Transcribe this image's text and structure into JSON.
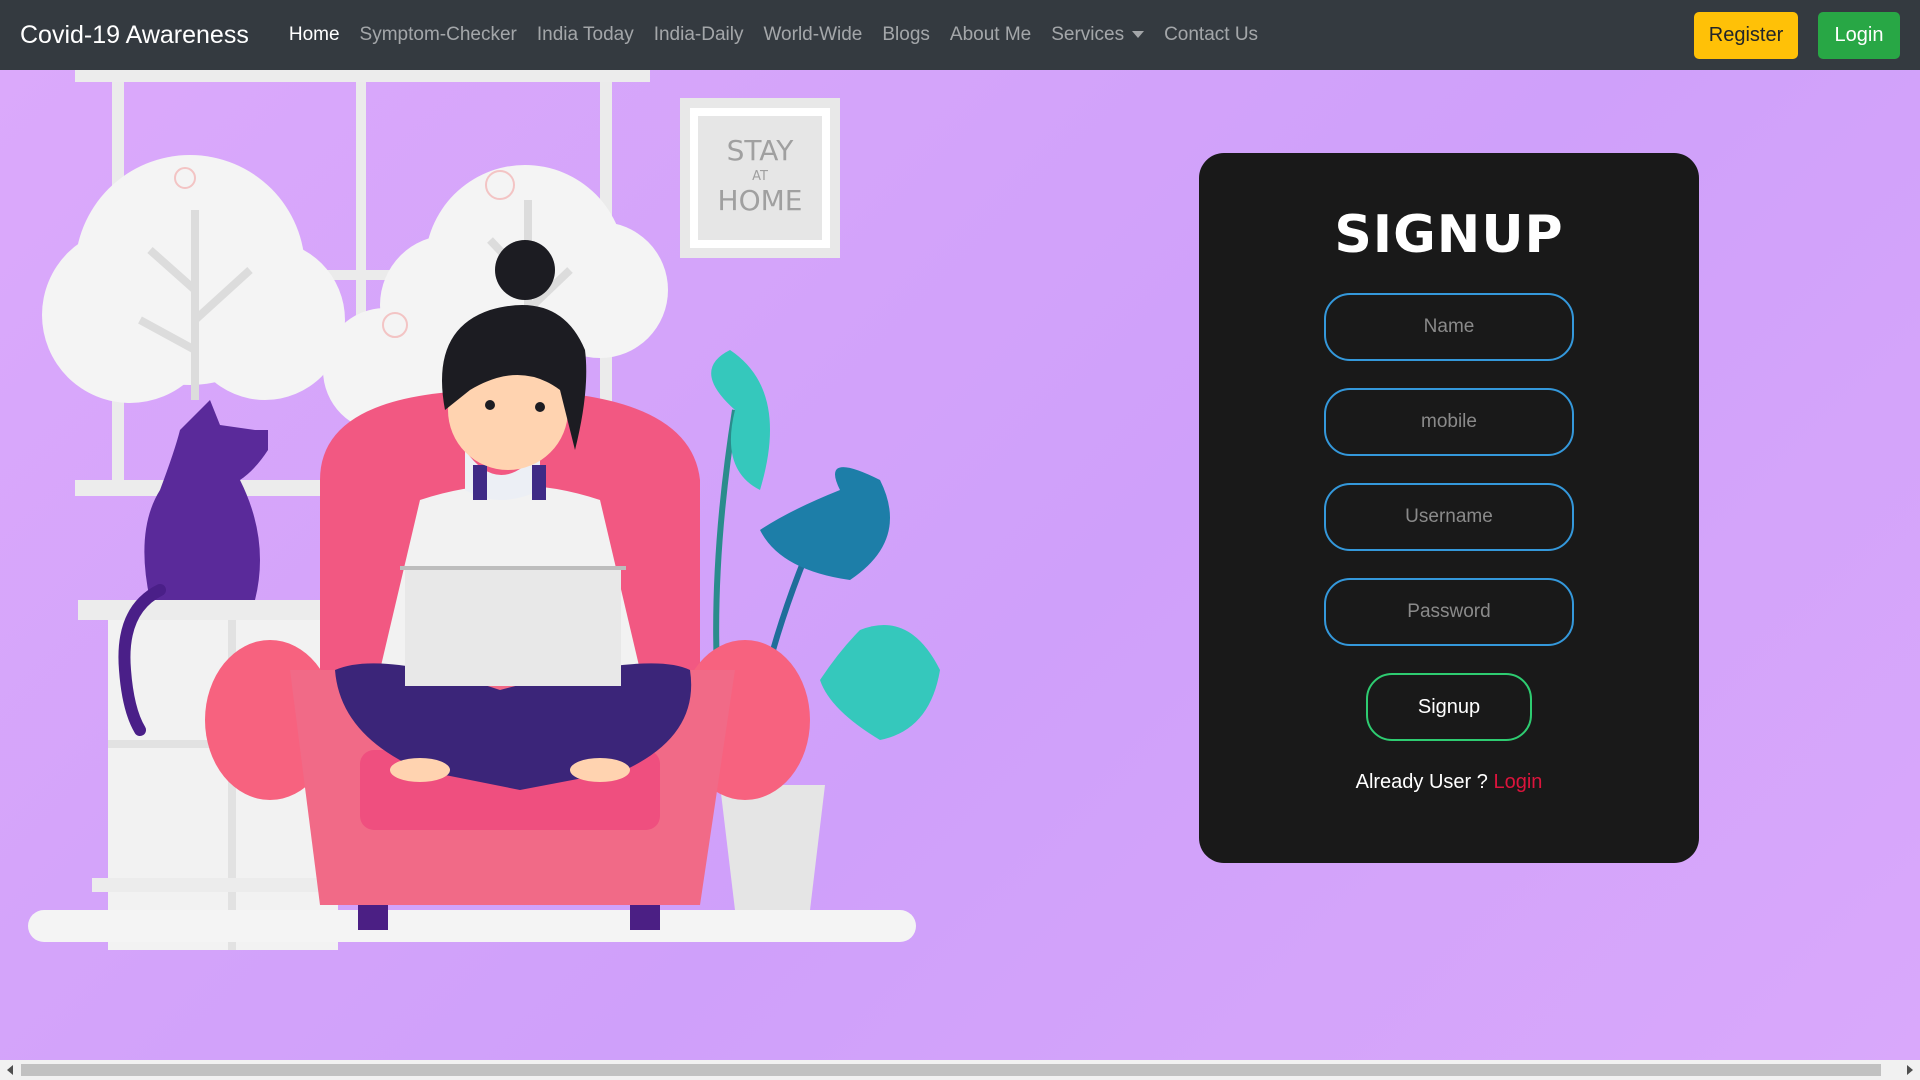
{
  "navbar": {
    "brand": "Covid-19 Awareness",
    "links": [
      {
        "label": "Home",
        "active": true
      },
      {
        "label": "Symptom-Checker"
      },
      {
        "label": "India Today"
      },
      {
        "label": "India-Daily"
      },
      {
        "label": "World-Wide"
      },
      {
        "label": "Blogs"
      },
      {
        "label": "About Me"
      },
      {
        "label": "Services",
        "dropdown": true
      },
      {
        "label": "Contact Us"
      }
    ],
    "register_label": "Register",
    "login_label": "Login"
  },
  "illustration": {
    "poster_line1": "STAY",
    "poster_line2": "AT",
    "poster_line3": "HOME"
  },
  "signup": {
    "title": "SIGNUP",
    "name_placeholder": "Name",
    "mobile_placeholder": "mobile",
    "username_placeholder": "Username",
    "password_placeholder": "Password",
    "button_label": "Signup",
    "already_text": "Already User ?",
    "login_link": "Login"
  },
  "colors": {
    "background": "#d9a8fb",
    "navbar": "#343a40",
    "card": "#191919",
    "input_border": "#3498db",
    "button_border": "#2ecc71",
    "login_link": "#dc143c",
    "register": "#ffc107",
    "login": "#28a745"
  }
}
